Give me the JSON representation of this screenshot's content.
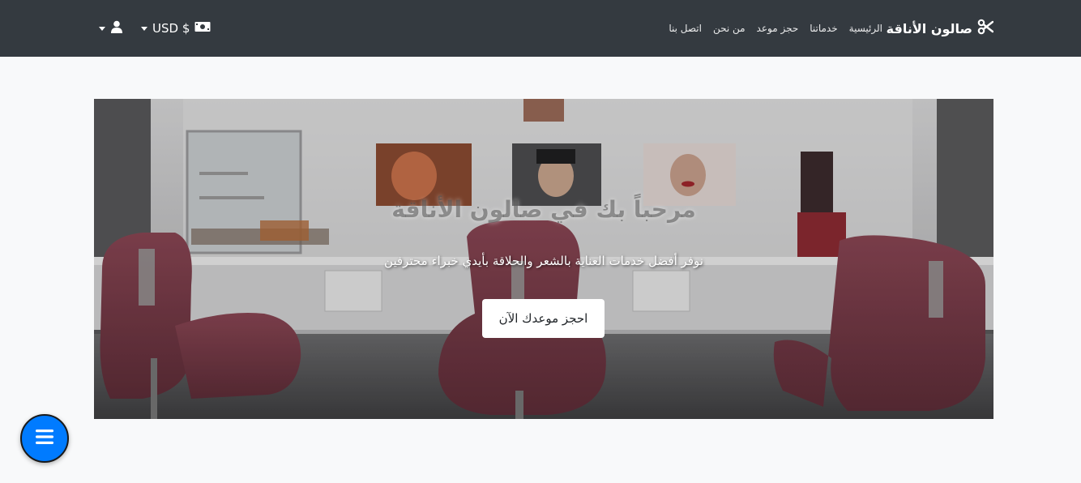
{
  "navbar": {
    "brand": "صالون الأناقة",
    "brand_icon": "scissors-icon",
    "links": [
      "الرئيسية",
      "خدماتنا",
      "حجز موعد",
      "من نحن",
      "اتصل بنا"
    ],
    "currency": "USD $",
    "currency_icon": "banknote-icon",
    "user_icon": "user-icon"
  },
  "hero": {
    "title": "مرحباً بك في صالون الأناقة",
    "subtitle": "نوفر أفضل خدمات العناية بالشعر والحلاقة بأيدي خبراء محترفين",
    "cta": "احجز موعدك الآن"
  },
  "fab": {
    "icon": "menu-icon"
  },
  "colors": {
    "navbar_bg": "#343a40",
    "page_bg": "#f8f9fa",
    "fab_bg": "#007bff",
    "chair": "#7a3a48"
  }
}
